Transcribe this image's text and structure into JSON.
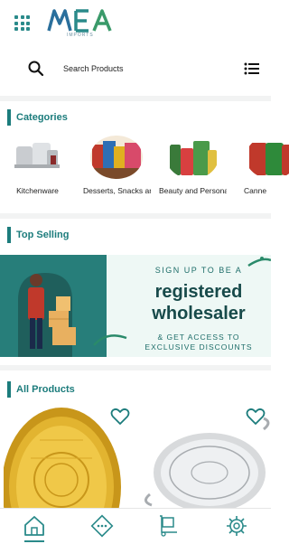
{
  "app": {
    "logo_text": "MEA",
    "logo_subtext": "IMPORTS",
    "accent_color": "#1c7c7c"
  },
  "search": {
    "placeholder": "Search Products"
  },
  "sections": {
    "categories": "Categories",
    "top_selling": "Top Selling",
    "all_products": "All Products"
  },
  "categories": [
    {
      "label": "Kitchenware"
    },
    {
      "label": "Desserts, Snacks and..."
    },
    {
      "label": "Beauty and Personal..."
    },
    {
      "label": "Canne"
    }
  ],
  "banner": {
    "line1": "SIGN UP TO BE A",
    "line2": "registered",
    "line3": "wholesaler",
    "line4a": "& GET ACCESS TO",
    "line4b": "EXCLUSIVE DISCOUNTS"
  },
  "products": [
    {
      "name": "gold-tray",
      "favorite": false
    },
    {
      "name": "silver-tray",
      "favorite": false
    }
  ],
  "bottom_nav": [
    {
      "icon": "home-icon",
      "active": true
    },
    {
      "icon": "more-icon",
      "active": false
    },
    {
      "icon": "delivery-icon",
      "active": false
    },
    {
      "icon": "settings-icon",
      "active": false
    }
  ]
}
